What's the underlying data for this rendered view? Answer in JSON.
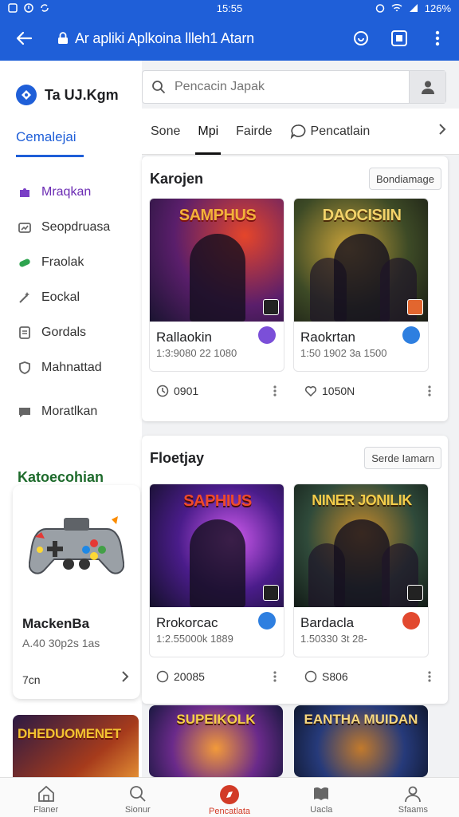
{
  "status_bar": {
    "time": "15:55",
    "battery": "126%"
  },
  "app_bar": {
    "title": "Ar apliki Aplkoina llleh1 Atarn"
  },
  "brand": {
    "name": "Ta UJ.Kgm"
  },
  "sidebar": {
    "tab": "Cemalejai",
    "items": [
      {
        "label": "Mraqkan",
        "icon": "puzzle-icon"
      },
      {
        "label": "Seopdruasa",
        "icon": "chart-icon"
      },
      {
        "label": "Fraolak",
        "icon": "pill-icon"
      },
      {
        "label": "Eockal",
        "icon": "wand-icon"
      },
      {
        "label": "Gordals",
        "icon": "document-icon"
      },
      {
        "label": "Mahnattad",
        "icon": "shield-icon"
      },
      {
        "label": "Moratlkan",
        "icon": "chat-icon"
      }
    ],
    "section_title": "Katoecohian",
    "promo": {
      "name": "MackenBa",
      "meta": "A.40 30p2s 1as",
      "count": "7cn"
    }
  },
  "search": {
    "placeholder": "Pencacin Japak"
  },
  "tabs": [
    {
      "label": "Sone"
    },
    {
      "label": "Mpi"
    },
    {
      "label": "Fairde"
    },
    {
      "label": "Pencatlain"
    }
  ],
  "panels": [
    {
      "title": "Karojen",
      "button": "Bondiamage",
      "cards": [
        {
          "art_title": "SAMPHUS",
          "name": "Rallaokin",
          "meta": "1:3:9080 22 1080",
          "stat": "0901",
          "dot": "#7b4fd8"
        },
        {
          "art_title": "DAOCISIIN",
          "name": "Raokrtan",
          "meta": "1:50 1902 3a 1500",
          "stat": "1050N",
          "dot": "#2e7fe0"
        }
      ]
    },
    {
      "title": "Floetjay",
      "button": "Serde Iamarn",
      "cards": [
        {
          "art_title": "SAPHIUS",
          "name": "Rrokorcac",
          "meta": "1:2.55000k 1889",
          "stat": "20085",
          "dot": "#2e7fe0"
        },
        {
          "art_title": "NINER JONILIK",
          "name": "Bardacla",
          "meta": "1.50330 3t 28-",
          "stat": "S806",
          "dot": "#e2492f"
        }
      ]
    }
  ],
  "bottom_row": [
    {
      "art_title": "DHEDUOMENET"
    },
    {
      "art_title": "SUPEIKOLK"
    },
    {
      "art_title": "EANTHA MUIDAN"
    }
  ],
  "bottom_nav": [
    {
      "label": "Flaner",
      "icon": "home-icon"
    },
    {
      "label": "Sionur",
      "icon": "search-icon"
    },
    {
      "label": "Pencatlata",
      "icon": "compass-icon"
    },
    {
      "label": "Uacla",
      "icon": "book-icon"
    },
    {
      "label": "Sfaams",
      "icon": "person-icon"
    }
  ]
}
